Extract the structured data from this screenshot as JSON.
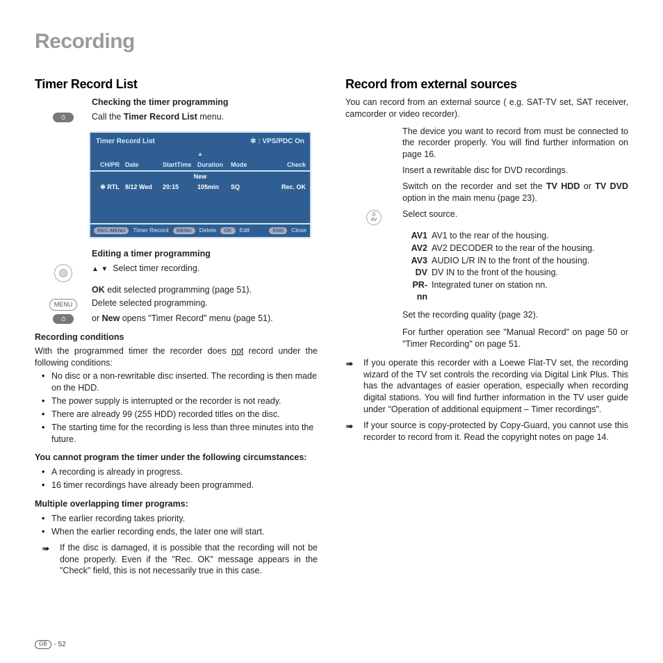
{
  "page": {
    "title": "Recording",
    "footer_badge": "GB",
    "footer_page": "- 52"
  },
  "left": {
    "heading": "Timer Record List",
    "check_h": "Checking the timer programming",
    "call_prefix": "Call the ",
    "call_bold": "Timer Record List",
    "call_suffix": " menu.",
    "edit_h": "Editing a timer programming",
    "select_text": "Select timer recording.",
    "ok_bold": "OK",
    "ok_rest": " edit selected programming (page 51).",
    "delete_text": "Delete selected programming.",
    "new_prefix": "or ",
    "new_bold": "New",
    "new_suffix": " opens \"Timer Record\" menu (page 51).",
    "rec_cond_h": "Recording conditions",
    "rec_cond_p1": "With the programmed timer the recorder does ",
    "rec_cond_not": "not",
    "rec_cond_p2": " record under the following conditions:",
    "rc_items": [
      "No disc or a non-rewritable disc inserted. The recording is then made on the HDD.",
      "The power supply is interrupted or the recorder is not ready.",
      "There are already 99 (255 HDD) recorded titles on the disc.",
      "The starting time for the recording is less than three minutes into the future."
    ],
    "cannot_h": "You cannot program the timer under the following circumstances:",
    "cannot_items": [
      "A recording is already in progress.",
      "16 timer recordings have already been programmed."
    ],
    "overlap_h": "Multiple overlapping timer programs:",
    "overlap_items": [
      "The earlier recording takes priority.",
      "When the earlier recording ends, the later one will start."
    ],
    "damaged_note": "If the disc is damaged, it is possible that the recording will not be done properly. Even if the \"Rec. OK\" message appears in the \"Check\" field, this is not necessarily true in this case."
  },
  "osd": {
    "title": "Timer Record List",
    "vps": "✻ : VPS/PDC On",
    "cols": {
      "chpr": "CH/PR",
      "date": "Date",
      "start": "StartTime",
      "dur": "Duration",
      "mode": "Mode",
      "check": "Check"
    },
    "new_label": "New",
    "row": {
      "chpr": "RTL",
      "date": "8/12 Wed",
      "start": "20:15",
      "dur": "105min",
      "mode": "SQ",
      "check": "Rec. OK"
    },
    "foot": {
      "recmenu_pill": "REC-MENU",
      "recmenu_txt": "Timer Record",
      "menu_pill": "MENU",
      "menu_txt": "Delete",
      "ok_pill": "OK",
      "ok_txt": "Edit",
      "end_pill": "END",
      "end_txt": "Close"
    }
  },
  "right": {
    "heading": "Record from external sources",
    "intro": "You can record from an external source ( e.g. SAT-TV set, SAT receiver, camcorder or video recorder).",
    "p1": "The device you want to record from must be connected to the recorder properly. You will find further information on page 16.",
    "p2": "Insert a rewritable disc for DVD recordings.",
    "p3a": "Switch on the recorder and set the ",
    "p3b": "TV HDD",
    "p3c": " or ",
    "p3d": "TV DVD",
    "p3e": " option in the main menu (page 23).",
    "select_source": "Select source.",
    "av_btn_top": "0",
    "av_btn_bot": "AV",
    "sources": [
      {
        "k": "AV1",
        "v": "AV1 to the rear of the housing."
      },
      {
        "k": "AV2",
        "v": "AV2 DECODER to the rear of the housing."
      },
      {
        "k": "AV3",
        "v": "AUDIO L/R IN to the front of the housing."
      },
      {
        "k": "DV",
        "v": "DV IN to the front of the housing."
      },
      {
        "k": "PR-nn",
        "v": "Integrated tuner on station nn."
      }
    ],
    "p4": "Set the recording quality (page 32).",
    "p5": "For further operation see \"Manual Record\" on page 50  or \"Timer Recording\" on page 51.",
    "note1": "If you operate this recorder with a Loewe Flat-TV set, the recording wizard of the TV set controls the recording via Digital Link Plus. This has the advantages of easier operation, especially when recording digital stations. You will find further information in the TV user guide under \"Operation of additional equipment – Timer recordings\".",
    "note2": "If your source is copy-protected by Copy-Guard, you cannot use this recorder to record from it. Read the copyright notes on page 14."
  },
  "labels": {
    "menu_btn": "MENU",
    "clock_icon": "⏱"
  }
}
